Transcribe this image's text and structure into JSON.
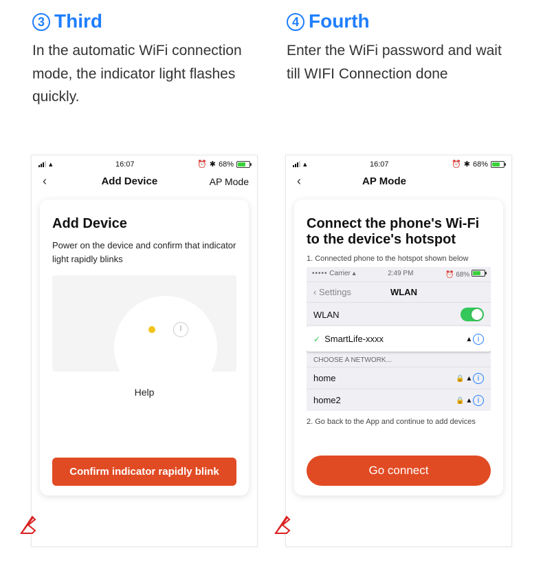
{
  "steps": [
    {
      "num": "3",
      "title": "Third",
      "desc": "In the automatic WiFi connection mode, the indicator light flashes quickly."
    },
    {
      "num": "4",
      "title": "Fourth",
      "desc": "Enter the WiFi password and wait till WIFI Connection done"
    }
  ],
  "status": {
    "time": "16:07",
    "battery": "68%"
  },
  "phone1": {
    "nav_title": "Add Device",
    "nav_right": "AP Mode",
    "card_title": "Add Device",
    "card_sub": "Power on the device and confirm that indicator light rapidly blinks",
    "help": "Help",
    "action": "Confirm indicator rapidly blink"
  },
  "phone2": {
    "nav_title": "AP Mode",
    "card_title": "Connect the phone's Wi-Fi to the device's hotspot",
    "li1": "1. Connected phone to the hotspot shown below",
    "li2": "2. Go back to the App and continue to add devices",
    "inner_status": {
      "carrier": "Carrier",
      "time": "2:49 PM",
      "batt": "68%"
    },
    "settings_back": "Settings",
    "wlan_title": "WLAN",
    "wlan_label": "WLAN",
    "selected_net": "SmartLife-xxxx",
    "choose_label": "CHOOSE A NETWORK...",
    "net1": "home",
    "net2": "home2",
    "action": "Go connect"
  }
}
